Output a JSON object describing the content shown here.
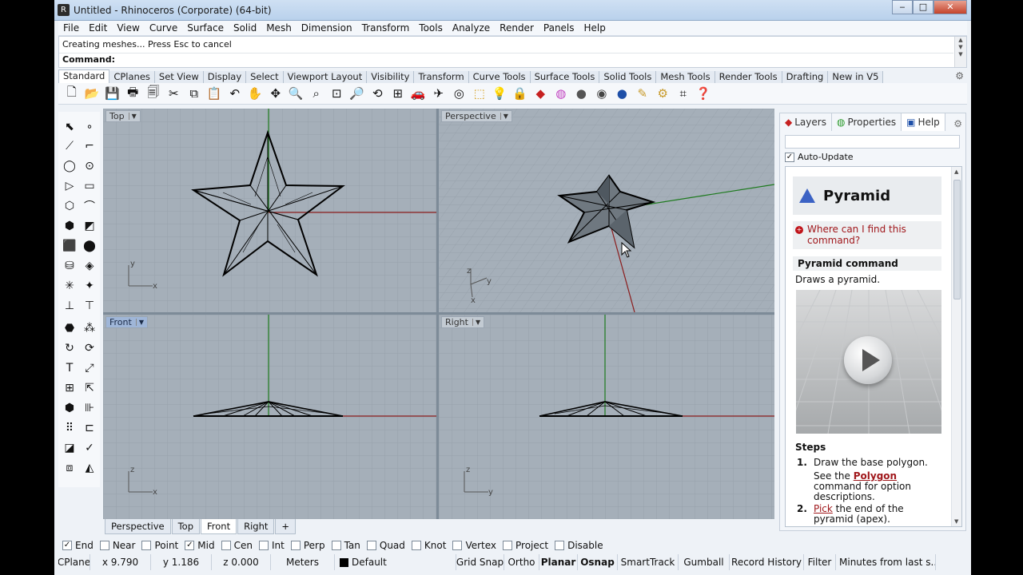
{
  "window": {
    "title": "Untitled - Rhinoceros (Corporate) (64-bit)",
    "min": "‒",
    "max": "□",
    "close": "✕"
  },
  "menu": [
    "File",
    "Edit",
    "View",
    "Curve",
    "Surface",
    "Solid",
    "Mesh",
    "Dimension",
    "Transform",
    "Tools",
    "Analyze",
    "Render",
    "Panels",
    "Help"
  ],
  "command": {
    "history": "Creating meshes... Press Esc to cancel",
    "prompt": "Command:"
  },
  "toolbar_tabs": [
    "Standard",
    "CPlanes",
    "Set View",
    "Display",
    "Select",
    "Viewport Layout",
    "Visibility",
    "Transform",
    "Curve Tools",
    "Surface Tools",
    "Solid Tools",
    "Mesh Tools",
    "Render Tools",
    "Drafting",
    "New in V5"
  ],
  "viewports": {
    "top": {
      "label": "Top",
      "axis1": "y",
      "axis2": "x"
    },
    "perspective": {
      "label": "Perspective",
      "axis1": "z",
      "axis2": "y",
      "axis3": "x"
    },
    "front": {
      "label": "Front",
      "axis1": "z",
      "axis2": "x"
    },
    "right": {
      "label": "Right",
      "axis1": "z",
      "axis2": "y"
    }
  },
  "viewport_tabs": [
    "Perspective",
    "Top",
    "Front",
    "Right"
  ],
  "viewport_tab_add": "+",
  "snaps": [
    {
      "label": "End",
      "checked": true
    },
    {
      "label": "Near",
      "checked": false
    },
    {
      "label": "Point",
      "checked": false
    },
    {
      "label": "Mid",
      "checked": true
    },
    {
      "label": "Cen",
      "checked": false
    },
    {
      "label": "Int",
      "checked": false
    },
    {
      "label": "Perp",
      "checked": false
    },
    {
      "label": "Tan",
      "checked": false
    },
    {
      "label": "Quad",
      "checked": false
    },
    {
      "label": "Knot",
      "checked": false
    },
    {
      "label": "Vertex",
      "checked": false
    },
    {
      "label": "Project",
      "checked": false
    },
    {
      "label": "Disable",
      "checked": false
    }
  ],
  "status": {
    "cplane": "CPlane",
    "x": "x 9.790",
    "y": "y 1.186",
    "z": "z 0.000",
    "units": "Meters",
    "layer": "Default",
    "grid_snap": "Grid Snap",
    "ortho": "Ortho",
    "planar": "Planar",
    "osnap": "Osnap",
    "smarttrack": "SmartTrack",
    "gumball": "Gumball",
    "record_history": "Record History",
    "filter": "Filter",
    "minutes": "Minutes from last s..."
  },
  "panel": {
    "tabs": [
      "Layers",
      "Properties",
      "Help"
    ],
    "auto_update": "Auto-Update",
    "help": {
      "title": "Pyramid",
      "find_link": "Where can I find this command?",
      "subtitle": "Pyramid command",
      "description": "Draws a pyramid.",
      "steps_heading": "Steps",
      "step1_num": "1.",
      "step1_text": "Draw the base polygon.",
      "step1_see": "See the ",
      "step1_link": "Polygon",
      "step1_rest": " command for option descriptions.",
      "step2_num": "2.",
      "step2_link": "Pick",
      "step2_rest": " the end of the pyramid (apex)."
    }
  },
  "colors": {
    "grid_bg": "#a5afb9",
    "grid_line": "#97a1ab",
    "x_axis": "#8b1c1c",
    "y_axis": "#1d7a1d",
    "link": "#a0171b",
    "active_vp": "#9fb6d8"
  }
}
